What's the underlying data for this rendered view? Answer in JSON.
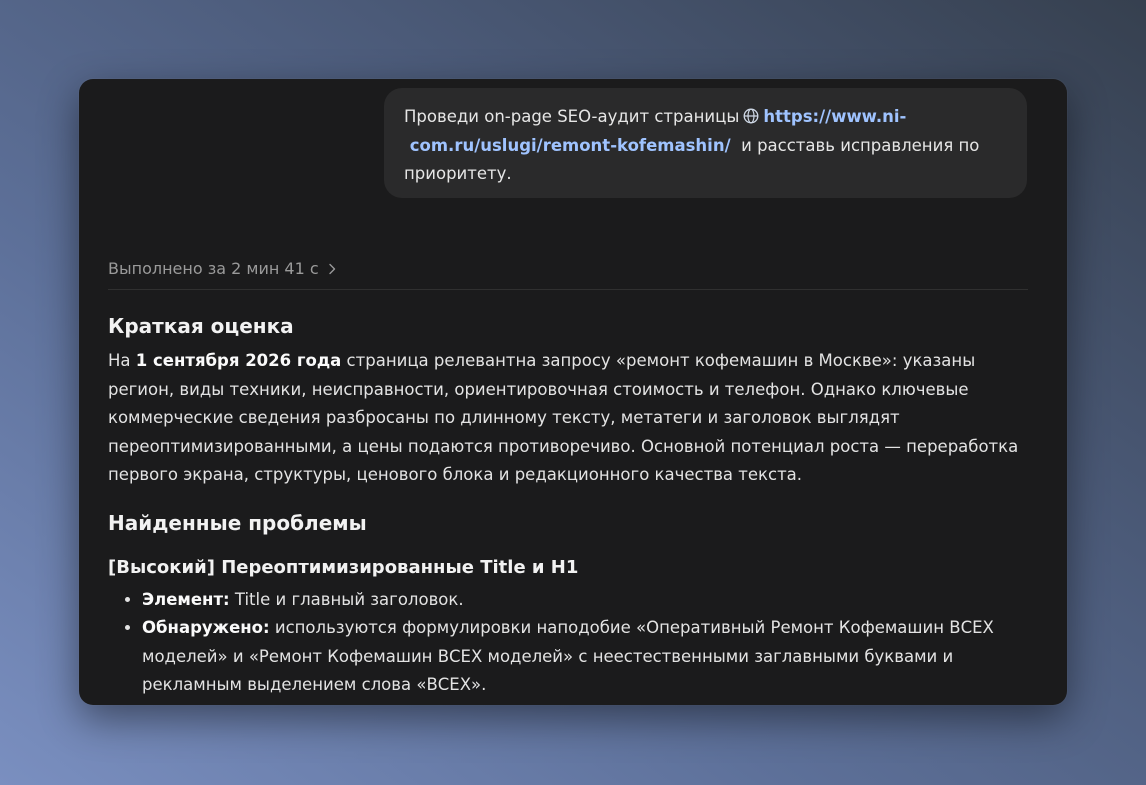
{
  "user_message": {
    "text_before": "Проведи on-page SEO-аудит страницы",
    "link": "https://www.ni-com.ru/uslugi/remont-kofemashin/",
    "link_line1": "https://www.ni-",
    "link_line2": "com.ru/uslugi/remont-kofemashin/",
    "text_after": "и расставь исправления по",
    "text_end": "приоритету."
  },
  "status": {
    "label": "Выполнено за 2 мин 41 с",
    "icon": "chevron-right-icon"
  },
  "summary": {
    "heading": "Краткая оценка",
    "prefix": "На",
    "date_bold": "1 сентября 2026 года",
    "body": "страница релевантна запросу «ремонт кофемашин в Москве»: указаны регион, виды техники, неисправности, ориентировочная стоимость и телефон. Однако ключевые коммерческие сведения разбросаны по длинному тексту, метатеги и заголовок выглядят переоптимизированными, а цены подаются противоречиво. Основной потенциал роста — переработка первого экрана, структуры, ценового блока и редакционного качества текста."
  },
  "problems": {
    "heading": "Найденные проблемы",
    "issue1": {
      "title": "[Высокий] Переоптимизированные Title и H1",
      "items": [
        {
          "label": "Элемент:",
          "text": "Title и главный заголовок."
        },
        {
          "label": "Обнаружено:",
          "text": "используются формулировки наподобие «Оперативный Ремонт Кофемашин ВСЕХ моделей» и «Ремонт Кофемашин ВСЕХ моделей» с неестественными заглавными буквами и рекламным выделением слова «ВСЕХ»."
        }
      ]
    }
  },
  "colors": {
    "link": "#9fc3ff",
    "panel": "#1b1b1c",
    "bubble": "#2a2a2b"
  }
}
